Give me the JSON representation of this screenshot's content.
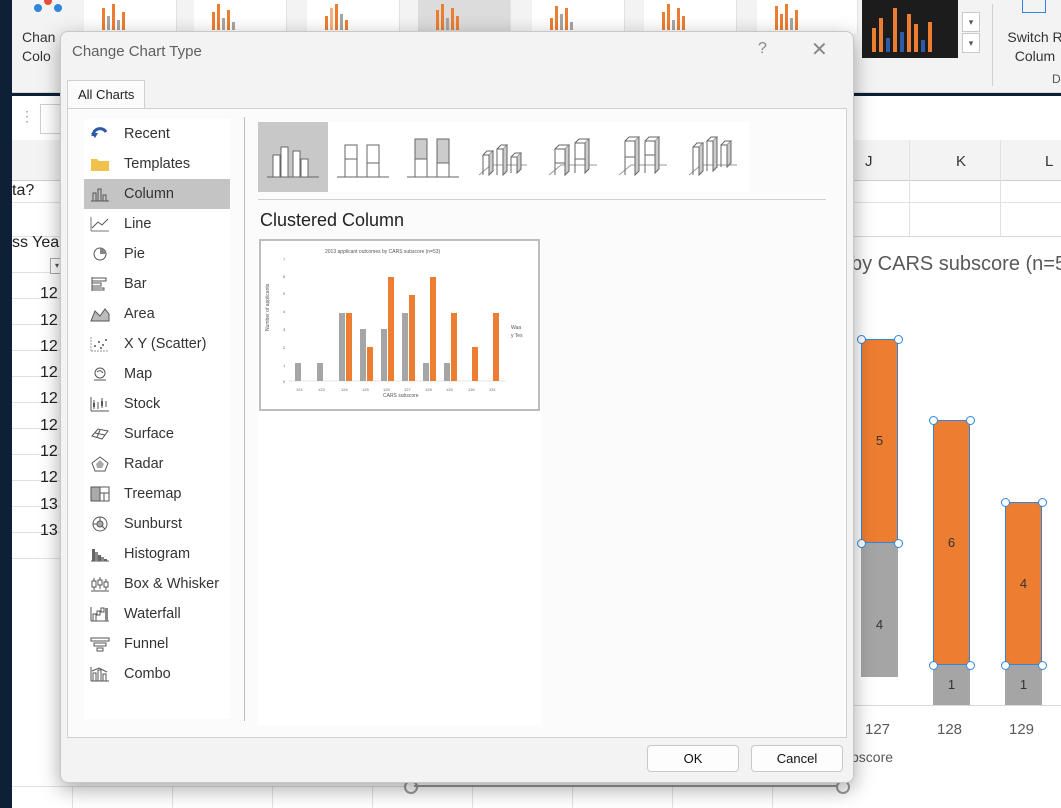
{
  "ribbon": {
    "change_colors_label_1": "Chan",
    "change_colors_label_2": "Colo",
    "switch_row_label_1": "Switch R",
    "switch_row_label_2": "Colum",
    "group_label": "D"
  },
  "sheet": {
    "columns": [
      "J",
      "K",
      "L"
    ],
    "cell_ta": "ta?",
    "cell_ss_year": "ss Yea",
    "row_values": [
      "12",
      "12",
      "12",
      "12",
      "12",
      "12",
      "12",
      "12",
      "13",
      "13"
    ]
  },
  "chart": {
    "title_partial": "by CARS subscore (n=5",
    "x_axis_partial": "bscore",
    "categories": [
      "127",
      "128",
      "129"
    ],
    "seg_values": {
      "c127_gray": "4",
      "c127_orange": "5",
      "c128_gray": "1",
      "c128_orange": "6",
      "c129_gray": "1",
      "c129_orange": "4"
    },
    "colors": {
      "gray": "#a5a5a5",
      "orange": "#ed7d31"
    }
  },
  "dialog": {
    "title": "Change Chart Type",
    "help": "?",
    "close": "✕",
    "tab_all_charts": "All Charts",
    "chart_types": [
      {
        "label": "Recent",
        "icon": "recent-icon"
      },
      {
        "label": "Templates",
        "icon": "folder-icon"
      },
      {
        "label": "Column",
        "icon": "column-chart-icon"
      },
      {
        "label": "Line",
        "icon": "line-chart-icon"
      },
      {
        "label": "Pie",
        "icon": "pie-chart-icon"
      },
      {
        "label": "Bar",
        "icon": "bar-chart-icon"
      },
      {
        "label": "Area",
        "icon": "area-chart-icon"
      },
      {
        "label": "X Y (Scatter)",
        "icon": "scatter-chart-icon"
      },
      {
        "label": "Map",
        "icon": "map-chart-icon"
      },
      {
        "label": "Stock",
        "icon": "stock-chart-icon"
      },
      {
        "label": "Surface",
        "icon": "surface-chart-icon"
      },
      {
        "label": "Radar",
        "icon": "radar-chart-icon"
      },
      {
        "label": "Treemap",
        "icon": "treemap-chart-icon"
      },
      {
        "label": "Sunburst",
        "icon": "sunburst-chart-icon"
      },
      {
        "label": "Histogram",
        "icon": "histogram-chart-icon"
      },
      {
        "label": "Box & Whisker",
        "icon": "box-whisker-chart-icon"
      },
      {
        "label": "Waterfall",
        "icon": "waterfall-chart-icon"
      },
      {
        "label": "Funnel",
        "icon": "funnel-chart-icon"
      },
      {
        "label": "Combo",
        "icon": "combo-chart-icon"
      }
    ],
    "selected_type": "Column",
    "subtype_name": "Clustered Column",
    "preview": {
      "title": "2013 applicant outcomes by CARS subscore (n=53)",
      "xlabel": "CARS subscore",
      "ylabel": "Number of applicants",
      "legend": [
        "Waa",
        "y Tes"
      ]
    },
    "ok_label": "OK",
    "cancel_label": "Cancel"
  }
}
